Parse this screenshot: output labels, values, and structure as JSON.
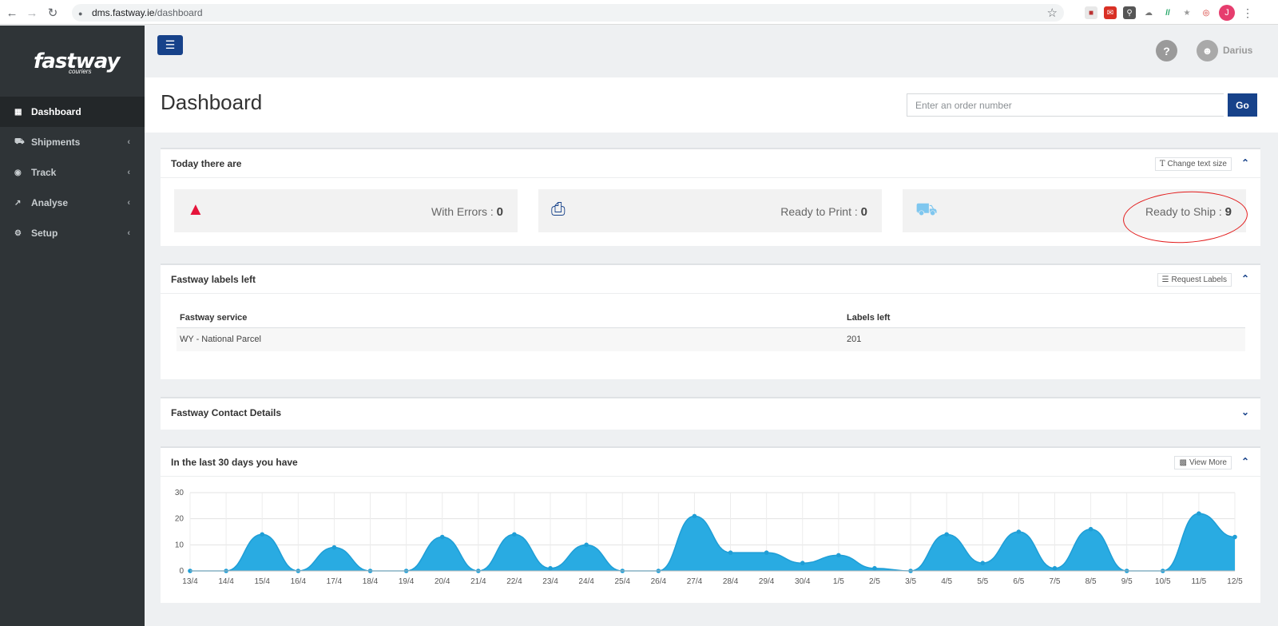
{
  "browser": {
    "url_host": "dms.fastway.ie",
    "url_path": "/dashboard",
    "profile_initial": "J"
  },
  "brand": {
    "logo": "fastway",
    "logo_sub": "couriers"
  },
  "sidebar": {
    "items": [
      {
        "label": "Dashboard",
        "icon": "dashboard-icon",
        "active": true
      },
      {
        "label": "Shipments",
        "icon": "truck-icon",
        "active": false
      },
      {
        "label": "Track",
        "icon": "target-icon",
        "active": false
      },
      {
        "label": "Analyse",
        "icon": "line-chart-icon",
        "active": false
      },
      {
        "label": "Setup",
        "icon": "gear-icon",
        "active": false
      }
    ]
  },
  "topbar": {
    "help": "?",
    "user_name": "Darius"
  },
  "header": {
    "title": "Dashboard",
    "order_placeholder": "Enter an order number",
    "go_label": "Go"
  },
  "today": {
    "title": "Today there are",
    "change_text_label": "Change text size",
    "stats": [
      {
        "label": "With Errors :",
        "value": "0",
        "icon": "warning-icon",
        "color": "#e5143b"
      },
      {
        "label": "Ready to Print :",
        "value": "0",
        "icon": "printer-icon",
        "color": "#17428a"
      },
      {
        "label": "Ready to Ship :",
        "value": "9",
        "icon": "truck-icon",
        "color": "#7fc7ef"
      }
    ]
  },
  "labels_left": {
    "title": "Fastway labels left",
    "request_label": "Request Labels",
    "columns": [
      "Fastway service",
      "Labels left"
    ],
    "rows": [
      [
        "WY - National Parcel",
        "201"
      ]
    ]
  },
  "contact": {
    "title": "Fastway Contact Details"
  },
  "last30": {
    "title": "In the last 30 days you have",
    "view_more_label": "View More"
  },
  "colors": {
    "accent": "#17428a",
    "chart_fill": "#29abe2",
    "sidebar": "#2f3437"
  },
  "chart_data": {
    "type": "area",
    "title": "",
    "xlabel": "",
    "ylabel": "",
    "ylim": [
      0,
      30
    ],
    "yticks": [
      0,
      10,
      20,
      30
    ],
    "grid": true,
    "categories": [
      "13/4",
      "14/4",
      "15/4",
      "16/4",
      "17/4",
      "18/4",
      "19/4",
      "20/4",
      "21/4",
      "22/4",
      "23/4",
      "24/4",
      "25/4",
      "26/4",
      "27/4",
      "28/4",
      "29/4",
      "30/4",
      "1/5",
      "2/5",
      "3/5",
      "4/5",
      "5/5",
      "6/5",
      "7/5",
      "8/5",
      "9/5",
      "10/5",
      "11/5",
      "12/5"
    ],
    "series": [
      {
        "values": [
          0,
          0,
          14,
          0,
          9,
          0,
          0,
          13,
          0,
          14,
          1,
          10,
          0,
          0,
          21,
          7,
          7,
          3,
          6,
          1,
          0,
          14,
          3,
          15,
          1,
          16,
          0,
          0,
          22,
          13
        ]
      }
    ]
  }
}
